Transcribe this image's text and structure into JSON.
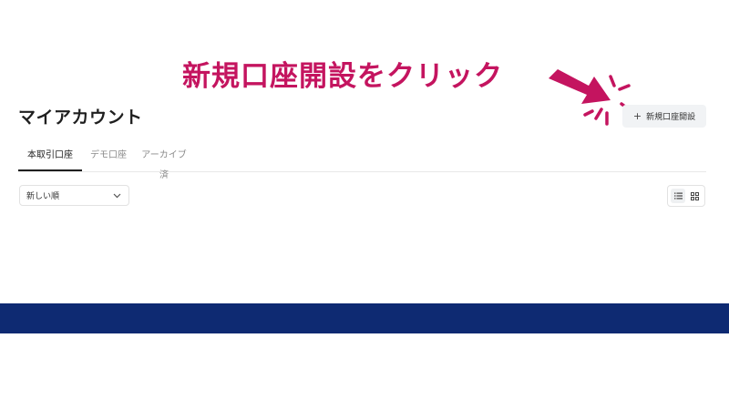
{
  "annotation": {
    "text": "新規口座開設をクリック",
    "color": "#c4145f"
  },
  "header": {
    "title": "マイアカウント",
    "new_account_button": {
      "icon": "plus-icon",
      "label": "新規口座開設"
    }
  },
  "tabs": [
    {
      "label": "本取引口座",
      "active": true
    },
    {
      "label": "デモ口座",
      "active": false
    },
    {
      "label": "アーカイブ済",
      "active": false
    }
  ],
  "sort_select": {
    "value": "新しい順",
    "icon": "chevron-down-icon"
  },
  "view_toggle": {
    "options": [
      {
        "icon": "list-view-icon",
        "active": true
      },
      {
        "icon": "grid-view-icon",
        "active": false
      }
    ]
  },
  "colors": {
    "bottom_band": "#0e2a72",
    "text_primary": "#1f1f1f",
    "text_muted": "#8a8a8a"
  }
}
